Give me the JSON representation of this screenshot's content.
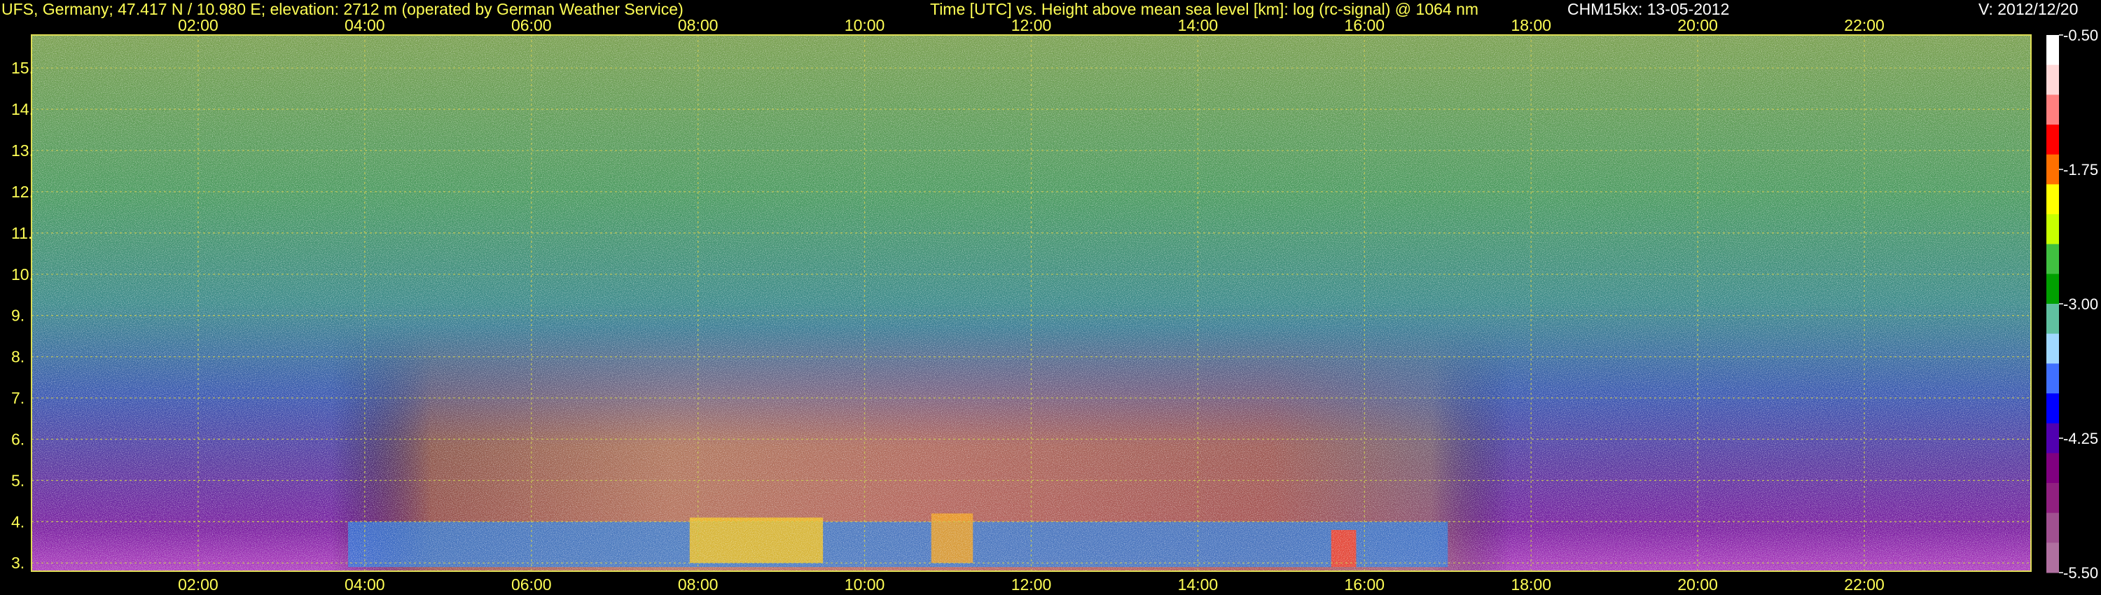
{
  "header": {
    "station": "UFS, Germany; 47.417 N / 10.980 E; elevation: 2712 m  (operated by German Weather Service)",
    "axes": "Time [UTC] vs. Height above mean sea level [km]: log (rc-signal) @ 1064 nm",
    "instrument": "CHM15kx: 13-05-2012",
    "version": "V: 2012/12/20"
  },
  "chart_data": {
    "type": "heatmap",
    "title": "",
    "xlabel": "Time [UTC]",
    "ylabel": "Height above mean sea level [km]",
    "xlim_hours": [
      0,
      24
    ],
    "ylim_km": [
      2.8,
      15.8
    ],
    "x_ticks": [
      "02:00",
      "04:00",
      "06:00",
      "08:00",
      "10:00",
      "12:00",
      "14:00",
      "16:00",
      "18:00",
      "20:00",
      "22:00"
    ],
    "x_tick_hours": [
      2,
      4,
      6,
      8,
      10,
      12,
      14,
      16,
      18,
      20,
      22
    ],
    "y_ticks": [
      "3.",
      "4.",
      "5.",
      "6.",
      "7.",
      "8.",
      "9.",
      "10.",
      "11.",
      "12.",
      "13.",
      "14.",
      "15."
    ],
    "y_tick_km": [
      3,
      4,
      5,
      6,
      7,
      8,
      9,
      10,
      11,
      12,
      13,
      14,
      15
    ],
    "grid": true,
    "colorbar": {
      "labels": [
        "-0.50",
        "-1.75",
        "-3.00",
        "-4.25",
        "-5.50"
      ],
      "range": [
        -5.5,
        -0.5
      ],
      "colors": [
        "#ffffff",
        "#ffd8d8",
        "#ff8080",
        "#ff0000",
        "#ff7000",
        "#ffff00",
        "#c8ff00",
        "#40c040",
        "#00a000",
        "#60c0a0",
        "#a0d8ff",
        "#4070ff",
        "#0000ff",
        "#5000b0",
        "#800080",
        "#902080",
        "#a05090",
        "#b070a0"
      ]
    },
    "features": [
      {
        "name": "boundary layer aerosol",
        "start_h": 3.8,
        "end_h": 17.0,
        "base_km": 2.9,
        "top_km": 4.0
      },
      {
        "name": "clouds",
        "start_h": 7.9,
        "end_h": 9.5,
        "base_km": 3.0,
        "top_km": 4.1
      },
      {
        "name": "clouds",
        "start_h": 10.8,
        "end_h": 11.3,
        "base_km": 3.0,
        "top_km": 4.2
      },
      {
        "name": "clouds",
        "start_h": 15.6,
        "end_h": 15.9,
        "base_km": 2.9,
        "top_km": 3.8
      }
    ]
  }
}
